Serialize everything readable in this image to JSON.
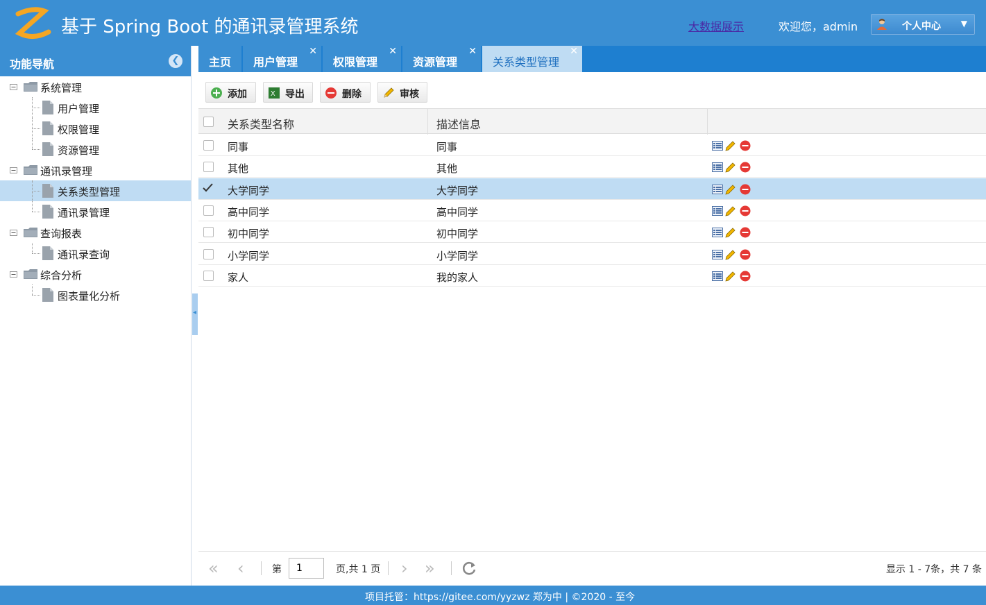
{
  "header": {
    "title": "基于 Spring Boot 的通讯录管理系统",
    "bigdata_link": "大数据展示",
    "welcome": "欢迎您，admin",
    "user_menu_label": "个人中心"
  },
  "sidebar": {
    "title": "功能导航",
    "groups": [
      {
        "label": "系统管理",
        "items": [
          "用户管理",
          "权限管理",
          "资源管理"
        ]
      },
      {
        "label": "通讯录管理",
        "items": [
          "关系类型管理",
          "通讯录管理"
        ]
      },
      {
        "label": "查询报表",
        "items": [
          "通讯录查询"
        ]
      },
      {
        "label": "综合分析",
        "items": [
          "图表量化分析"
        ]
      }
    ],
    "selected_item": "关系类型管理"
  },
  "tabs": [
    {
      "label": "主页",
      "closable": false
    },
    {
      "label": "用户管理",
      "closable": true
    },
    {
      "label": "权限管理",
      "closable": true
    },
    {
      "label": "资源管理",
      "closable": true
    },
    {
      "label": "关系类型管理",
      "closable": true,
      "active": true
    }
  ],
  "toolbar": {
    "add": "添加",
    "export": "导出",
    "delete": "删除",
    "audit": "审核"
  },
  "table": {
    "columns": [
      "关系类型名称",
      "描述信息"
    ],
    "rows": [
      {
        "name": "同事",
        "desc": "同事",
        "checked": false
      },
      {
        "name": "其他",
        "desc": "其他",
        "checked": false
      },
      {
        "name": "大学同学",
        "desc": "大学同学",
        "checked": true
      },
      {
        "name": "高中同学",
        "desc": "高中同学",
        "checked": false
      },
      {
        "name": "初中同学",
        "desc": "初中同学",
        "checked": false
      },
      {
        "name": "小学同学",
        "desc": "小学同学",
        "checked": false
      },
      {
        "name": "家人",
        "desc": "我的家人",
        "checked": false
      }
    ]
  },
  "pager": {
    "page_prefix": "第",
    "page_value": "1",
    "page_suffix": "页,共 1 页",
    "info": "显示 1 - 7条，共 7 条"
  },
  "footer": {
    "text": "项目托管：https://gitee.com/yyzwz 郑为中 | ©2020 - 至今"
  },
  "colors": {
    "primary": "#3b8fd3",
    "tabbar": "#1e7fd0",
    "selected": "#bfdcf3"
  }
}
